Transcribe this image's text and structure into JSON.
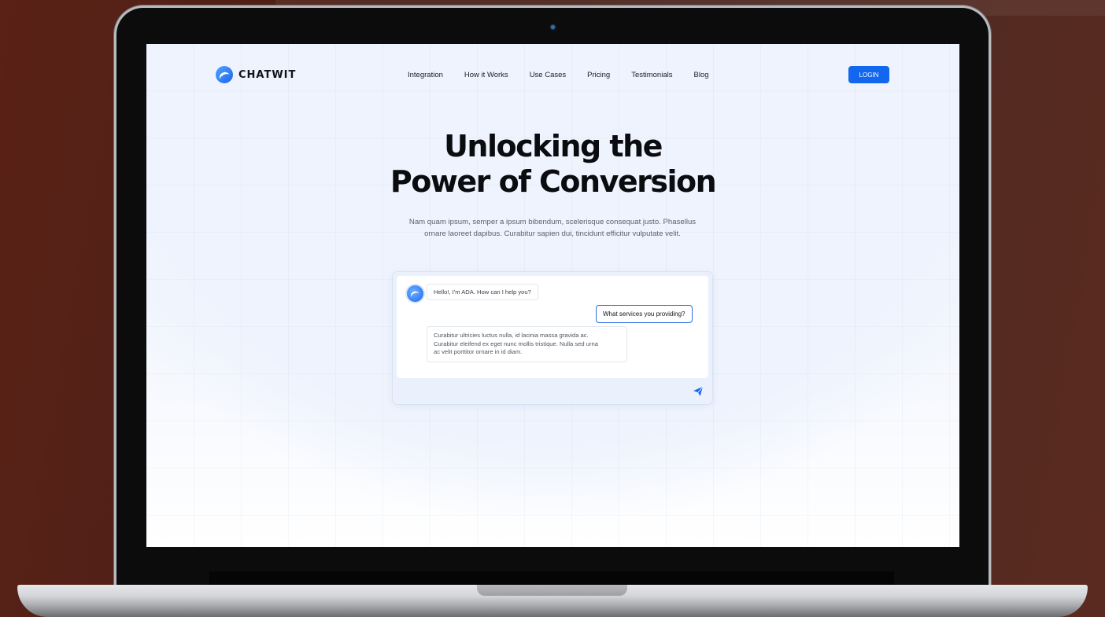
{
  "brand": {
    "name": "CHATWIT",
    "accent_color": "#1267ee"
  },
  "nav": {
    "items": [
      {
        "label": "Integration"
      },
      {
        "label": "How it Works"
      },
      {
        "label": "Use Cases"
      },
      {
        "label": "Pricing"
      },
      {
        "label": "Testimonials"
      },
      {
        "label": "Blog"
      }
    ],
    "login_label": "LOGIN"
  },
  "hero": {
    "title_line1": "Unlocking the",
    "title_line2": "Power of Conversion",
    "subtitle_line1": "Nam quam ipsum, semper a ipsum bibendum, scelerisque consequat justo. Phasellus",
    "subtitle_line2": "ornare laoreet dapibus. Curabitur sapien dui, tincidunt efficitur vulputate velit."
  },
  "chat": {
    "bot_greeting": "Hello!, I'm ADA. How can I help you?",
    "user_message": "What services you providing?",
    "bot_reply_line1": "Curabitur ultricies luctus nulla, id lacinia massa gravida ac.",
    "bot_reply_line2": "Curabitur eleifend ex eget nunc mollis tristique. Nulla sed urna",
    "bot_reply_line3": "ac velit porttitor ornare in id diam.",
    "send_icon": "send-icon"
  }
}
